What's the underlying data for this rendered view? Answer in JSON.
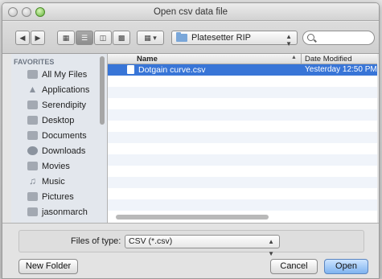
{
  "window": {
    "title": "Open csv data file"
  },
  "toolbar": {
    "back_icon": "chevron-left-icon",
    "forward_icon": "chevron-right-icon",
    "location": "Platesetter RIP",
    "search_value": "",
    "search_placeholder": ""
  },
  "sidebar": {
    "heading": "FAVORITES",
    "items": [
      {
        "label": "All My Files",
        "icon": "all-files-icon"
      },
      {
        "label": "Applications",
        "icon": "applications-icon"
      },
      {
        "label": "Serendipity",
        "icon": "folder-icon"
      },
      {
        "label": "Desktop",
        "icon": "desktop-icon"
      },
      {
        "label": "Documents",
        "icon": "documents-icon"
      },
      {
        "label": "Downloads",
        "icon": "downloads-icon"
      },
      {
        "label": "Movies",
        "icon": "movies-icon"
      },
      {
        "label": "Music",
        "icon": "music-icon"
      },
      {
        "label": "Pictures",
        "icon": "pictures-icon"
      },
      {
        "label": "jasonmarch",
        "icon": "home-icon"
      }
    ]
  },
  "filelist": {
    "columns": {
      "name": "Name",
      "date": "Date Modified"
    },
    "rows": [
      {
        "name": "Dotgain curve.csv",
        "date": "Yesterday 12:50 PM",
        "selected": true
      }
    ]
  },
  "bottom": {
    "types_label": "Files of type:",
    "types_value": "CSV (*.csv)",
    "new_folder": "New Folder",
    "cancel": "Cancel",
    "open": "Open"
  },
  "colors": {
    "selection": "#3875d7",
    "sidebar_bg": "#e3e7ed",
    "primary_button": "#7fb3f0"
  }
}
